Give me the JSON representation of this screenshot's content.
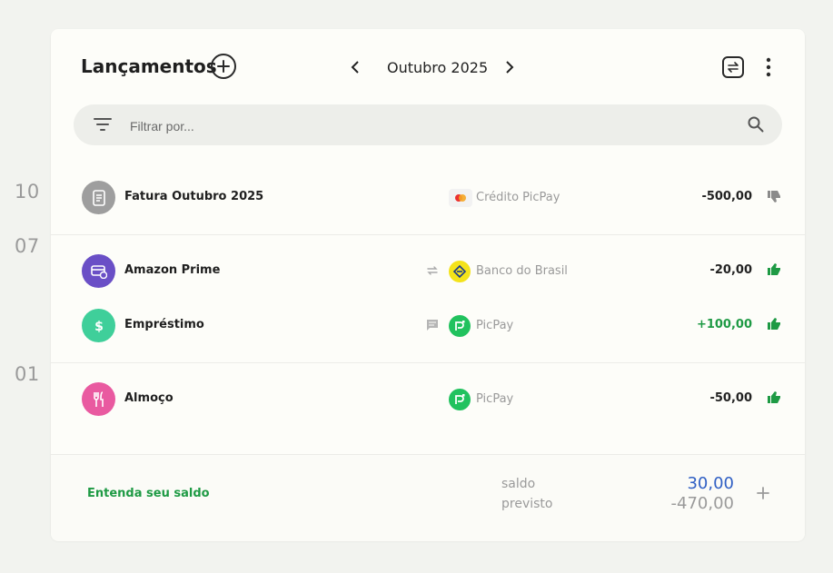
{
  "header": {
    "title": "Lançamentos",
    "month": "Outubro 2025"
  },
  "search": {
    "placeholder": "Filtrar por..."
  },
  "days": [
    "10",
    "07",
    "01"
  ],
  "transactions": [
    {
      "description": "Fatura Outubro 2025",
      "icon": "invoice-icon",
      "avatar_color": "#9e9e9e",
      "account": "Crédito PicPay",
      "account_logo": "mastercard-logo",
      "amount": "-500,00",
      "status": "thumb-down-icon",
      "status_color": "#8a8a8a"
    },
    {
      "description": "Amazon Prime",
      "icon": "subscription-icon",
      "avatar_color": "#6a4fc6",
      "meta_icon": "repeat-icon",
      "account": "Banco do Brasil",
      "account_logo": "banco-do-brasil-logo",
      "amount": "-20,00",
      "status": "thumb-up-icon",
      "status_color": "#1e9a44"
    },
    {
      "description": "Empréstimo",
      "icon": "dollar-icon",
      "avatar_color": "#3fcf9a",
      "meta_icon": "comment-icon",
      "account": "PicPay",
      "account_logo": "picpay-logo",
      "amount": "+100,00",
      "status": "thumb-up-icon",
      "status_color": "#1e9a44"
    },
    {
      "description": "Almoço",
      "icon": "fork-knife-icon",
      "avatar_color": "#e95aa0",
      "account": "PicPay",
      "account_logo": "picpay-logo",
      "amount": "-50,00",
      "status": "thumb-up-icon",
      "status_color": "#1e9a44"
    }
  ],
  "footer": {
    "link": "Entenda seu saldo",
    "saldo_label": "saldo",
    "saldo_value": "30,00",
    "previsto_label": "previsto",
    "previsto_value": "-470,00"
  },
  "colors": {
    "accent_green": "#1e9a44",
    "saldo_blue": "#2f5fc4",
    "background": "#f2f3ef",
    "card": "#fdfdf9"
  }
}
